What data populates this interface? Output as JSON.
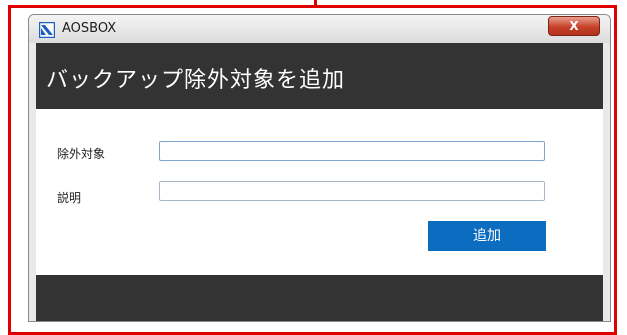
{
  "window": {
    "title": "AOSBOX",
    "close_label": "X"
  },
  "dialog": {
    "heading": "バックアップ除外対象を追加",
    "fields": [
      {
        "label": "除外対象",
        "value": ""
      },
      {
        "label": "説明",
        "value": ""
      }
    ],
    "add_button": "追加"
  },
  "colors": {
    "header_bg": "#333333",
    "button_bg": "#0b6cc0",
    "annotation": "#e00000",
    "close_button": "#c7412a"
  },
  "icons": {
    "app": "aosbox-logo-icon"
  }
}
